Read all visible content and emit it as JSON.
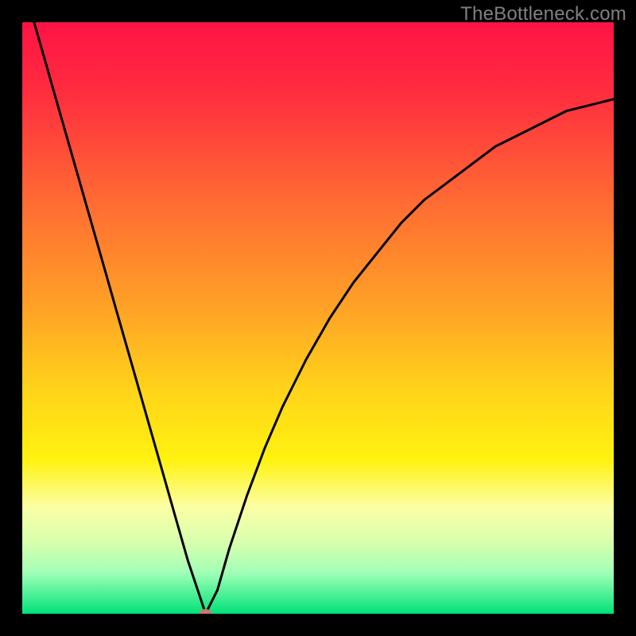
{
  "watermark": "TheBottleneck.com",
  "colors": {
    "gradient_stops": [
      {
        "offset": "0%",
        "color": "#ff1345"
      },
      {
        "offset": "12%",
        "color": "#ff2d3f"
      },
      {
        "offset": "30%",
        "color": "#ff6a33"
      },
      {
        "offset": "48%",
        "color": "#ffa126"
      },
      {
        "offset": "62%",
        "color": "#ffd31a"
      },
      {
        "offset": "74%",
        "color": "#fff210"
      },
      {
        "offset": "82%",
        "color": "#fbffa6"
      },
      {
        "offset": "88%",
        "color": "#d8ffad"
      },
      {
        "offset": "93%",
        "color": "#a2ffb7"
      },
      {
        "offset": "100%",
        "color": "#00e27a"
      }
    ],
    "curve": "#000000",
    "marker": "#c77a6e",
    "frame": "#000000"
  },
  "chart_data": {
    "type": "line",
    "title": "",
    "xlabel": "",
    "ylabel": "",
    "xlim": [
      0,
      100
    ],
    "ylim": [
      0,
      100
    ],
    "x": [
      2,
      4,
      6,
      8,
      10,
      12,
      14,
      16,
      18,
      20,
      22,
      24,
      26,
      28,
      30,
      31,
      33,
      35,
      38,
      41,
      44,
      48,
      52,
      56,
      60,
      64,
      68,
      72,
      76,
      80,
      84,
      88,
      92,
      96,
      100
    ],
    "values": [
      100,
      93,
      86,
      79,
      72,
      65,
      58,
      51,
      44,
      37,
      30,
      23,
      16,
      9,
      3,
      0,
      4,
      11,
      20,
      28,
      35,
      43,
      50,
      56,
      61,
      66,
      70,
      73,
      76,
      79,
      81,
      83,
      85,
      86,
      87
    ],
    "marker": {
      "x": 31,
      "y": 0
    }
  }
}
